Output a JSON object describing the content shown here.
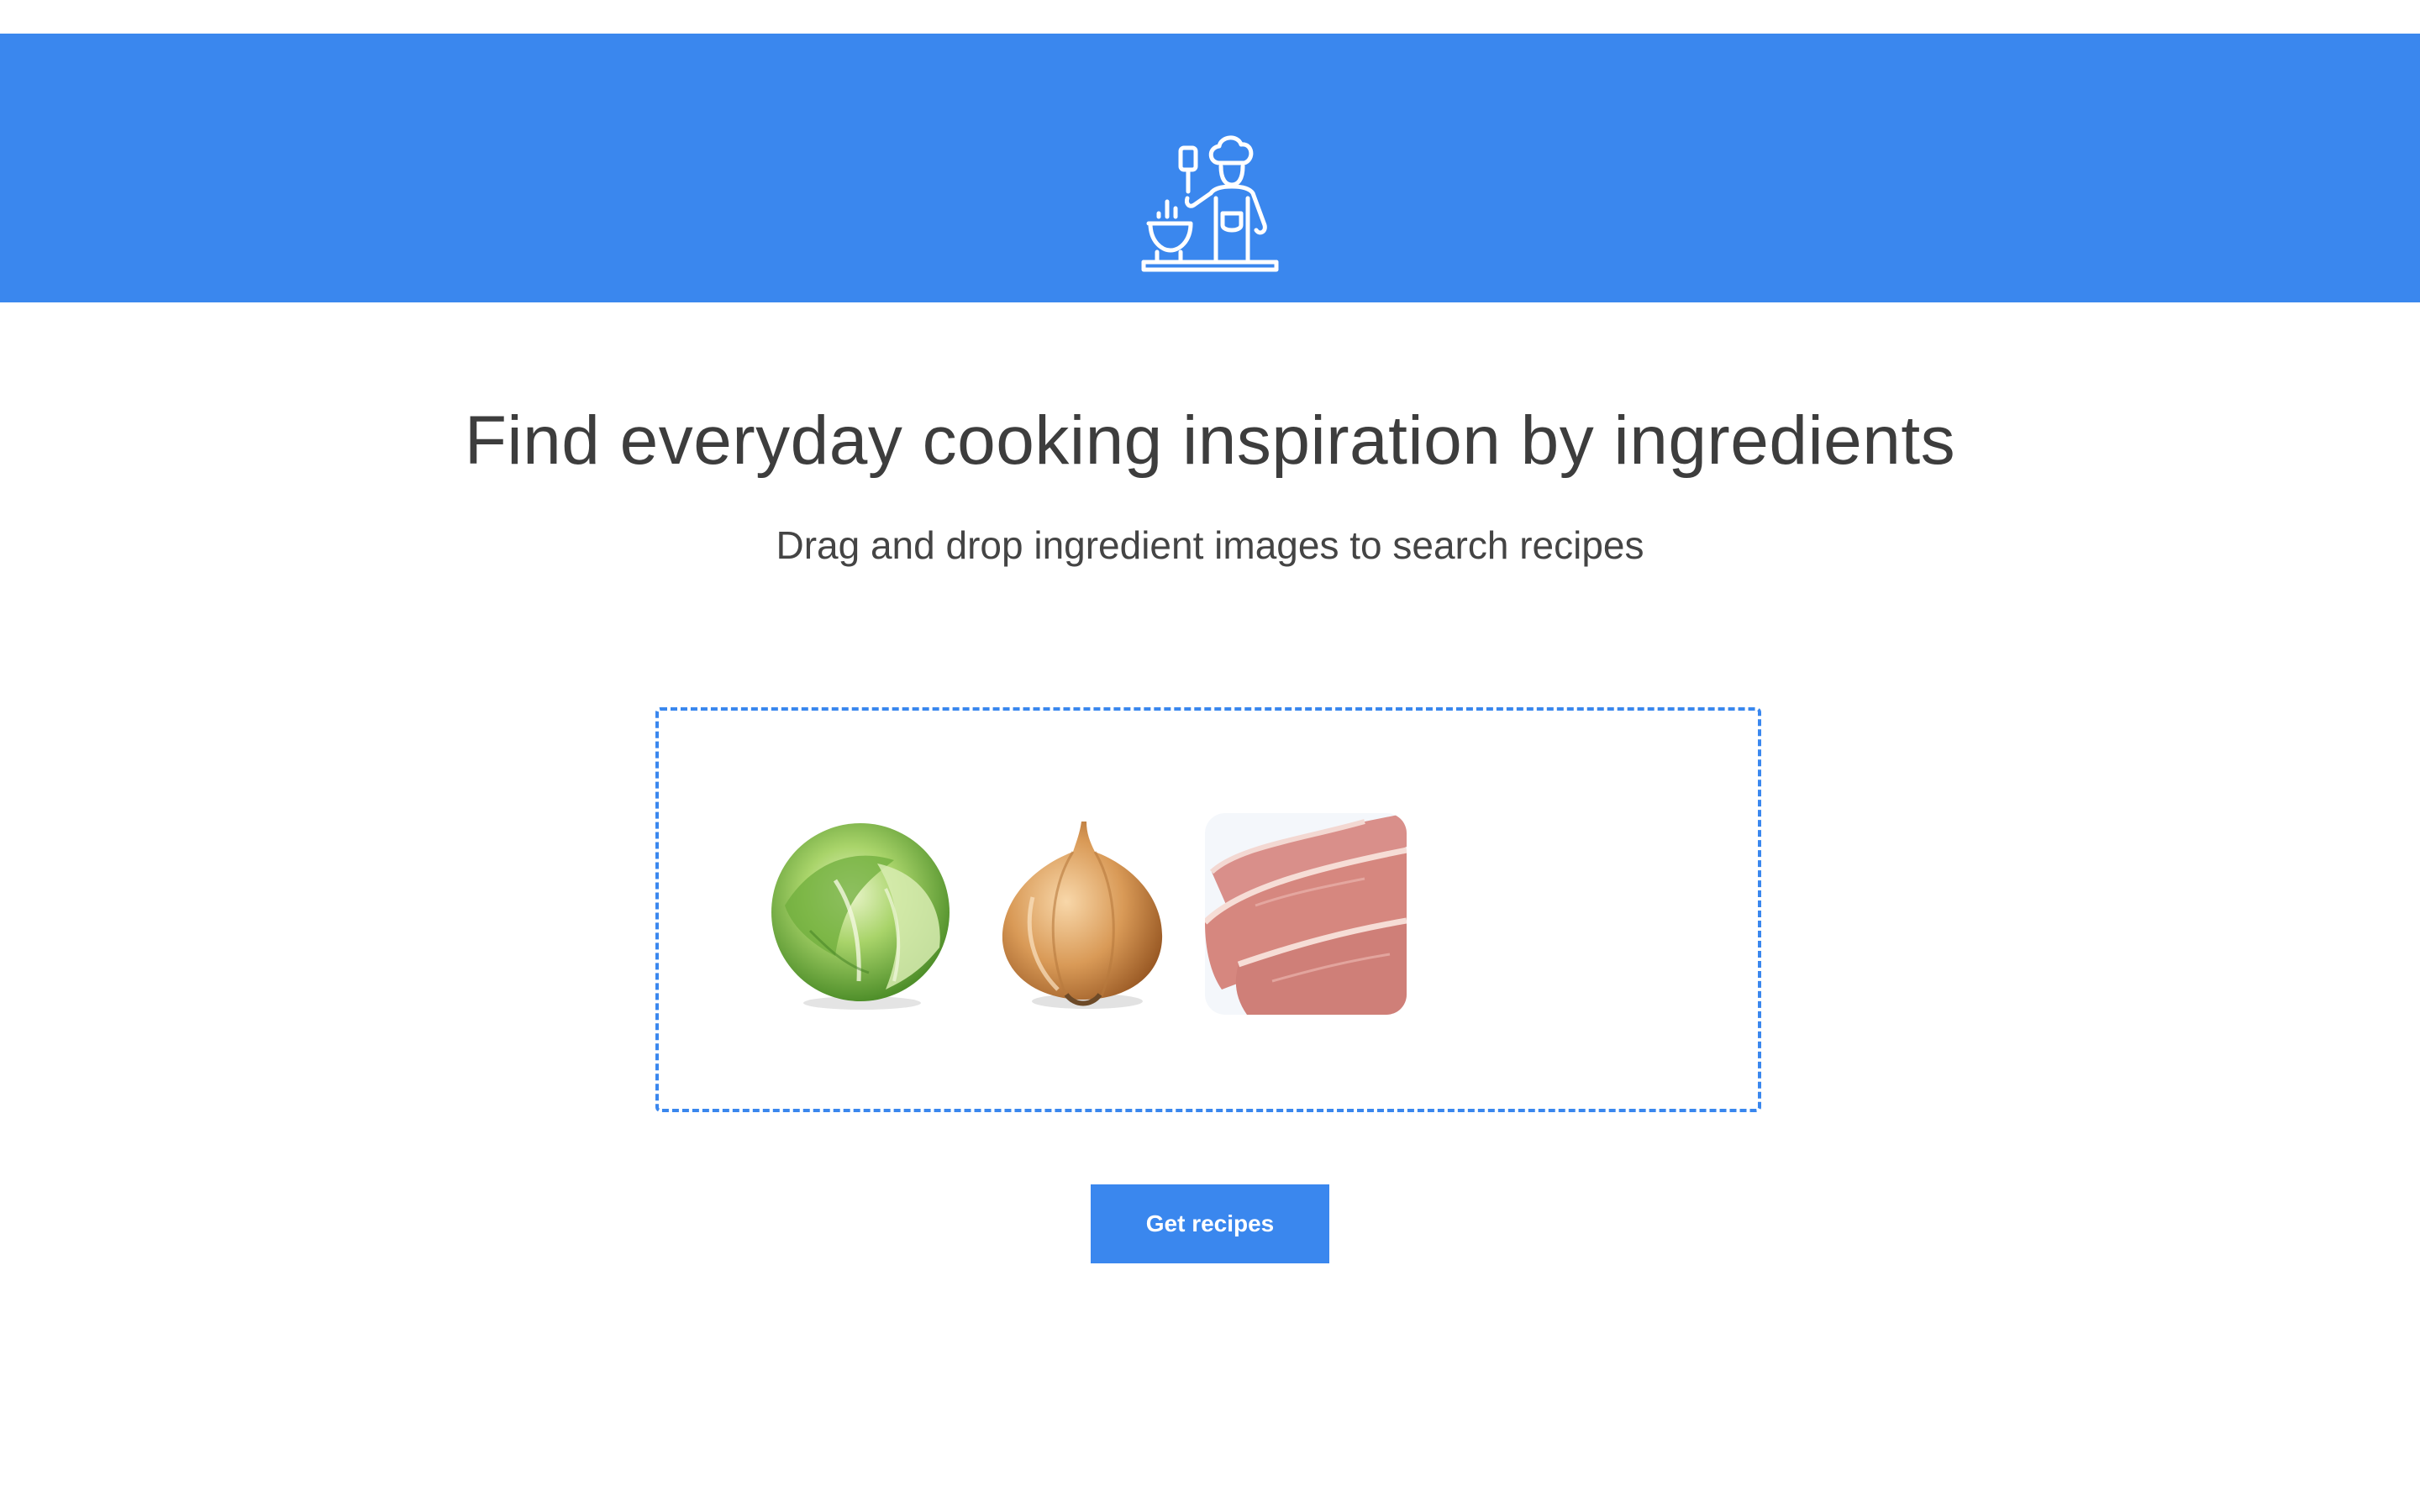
{
  "header": {
    "logo_icon": "chef-cooking-icon",
    "background_color": "#3a87ee"
  },
  "main": {
    "headline": "Find everyday cooking inspiration by ingredients",
    "subheadline": "Drag and drop ingredient images to search recipes"
  },
  "dropzone": {
    "border_color": "#3a87ee",
    "ingredients": [
      {
        "icon": "lettuce-image"
      },
      {
        "icon": "onion-image"
      },
      {
        "icon": "pork-chop-image"
      }
    ]
  },
  "actions": {
    "get_recipes_label": "Get recipes"
  }
}
